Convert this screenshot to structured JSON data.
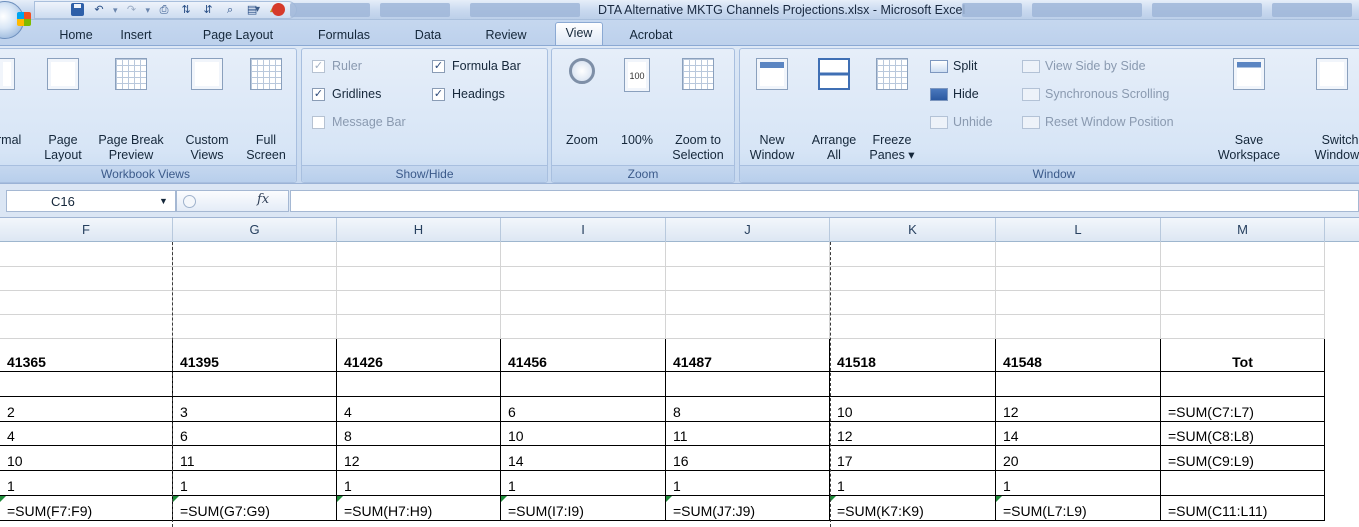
{
  "window": {
    "title": "DTA Alternative MKTG Channels Projections.xlsx - Microsoft Excel"
  },
  "ribbon_tabs": [
    {
      "label": "Home"
    },
    {
      "label": "Insert"
    },
    {
      "label": "Page Layout"
    },
    {
      "label": "Formulas"
    },
    {
      "label": "Data"
    },
    {
      "label": "Review"
    },
    {
      "label": "View",
      "active": true
    },
    {
      "label": "Acrobat"
    }
  ],
  "ribbon": {
    "workbook_views": {
      "label": "Workbook Views",
      "buttons": {
        "normal": "rmal",
        "page_layout": "Page\nLayout",
        "page_break_preview": "Page Break\nPreview",
        "custom_views": "Custom\nViews",
        "full_screen": "Full\nScreen"
      }
    },
    "show_hide": {
      "label": "Show/Hide",
      "ruler": {
        "label": "Ruler",
        "checked": true,
        "enabled": false
      },
      "gridlines": {
        "label": "Gridlines",
        "checked": true
      },
      "message_bar": {
        "label": "Message Bar",
        "checked": false,
        "enabled": false
      },
      "formula_bar": {
        "label": "Formula Bar",
        "checked": true
      },
      "headings": {
        "label": "Headings",
        "checked": true
      }
    },
    "zoom": {
      "label": "Zoom",
      "buttons": {
        "zoom": "Zoom",
        "hundred": "100%",
        "zoom_to_selection": "Zoom to\nSelection"
      },
      "hundred_icon_text": "100"
    },
    "window": {
      "label": "Window",
      "buttons": {
        "new_window": "New\nWindow",
        "arrange_all": "Arrange\nAll",
        "freeze_panes": "Freeze\nPanes ▾",
        "split": "Split",
        "hide": "Hide",
        "unhide": "Unhide",
        "view_side_by_side": "View Side by Side",
        "synchronous_scrolling": "Synchronous Scrolling",
        "reset_window_position": "Reset Window Position",
        "save_workspace": "Save\nWorkspace",
        "switch_windows": "Switch\nWindows"
      }
    }
  },
  "formula_bar": {
    "name_box": "C16",
    "fx_label": "fx",
    "formula": ""
  },
  "sheet": {
    "columns": [
      "F",
      "G",
      "H",
      "I",
      "J",
      "K",
      "L",
      "M"
    ],
    "rows": [
      {
        "cells": [
          "",
          "",
          "",
          "",
          "",
          "",
          "",
          ""
        ]
      },
      {
        "cells": [
          "",
          "",
          "",
          "",
          "",
          "",
          "",
          ""
        ]
      },
      {
        "cells": [
          "",
          "",
          "",
          "",
          "",
          "",
          "",
          ""
        ]
      },
      {
        "cells": [
          "",
          "",
          "",
          "",
          "",
          "",
          "",
          ""
        ]
      },
      {
        "cells": [
          "41365",
          "41395",
          "41426",
          "41456",
          "41487",
          "41518",
          "41548",
          "Tot"
        ],
        "bold": true
      },
      {
        "cells": [
          "",
          "",
          "",
          "",
          "",
          "",
          "",
          ""
        ]
      },
      {
        "cells": [
          "2",
          "3",
          "4",
          "6",
          "8",
          "10",
          "12",
          "=SUM(C7:L7)"
        ]
      },
      {
        "cells": [
          "4",
          "6",
          "8",
          "10",
          "11",
          "12",
          "14",
          "=SUM(C8:L8)"
        ]
      },
      {
        "cells": [
          "10",
          "11",
          "12",
          "14",
          "16",
          "17",
          "20",
          "=SUM(C9:L9)"
        ]
      },
      {
        "cells": [
          "1",
          "1",
          "1",
          "1",
          "1",
          "1",
          "1",
          ""
        ]
      },
      {
        "cells": [
          "=SUM(F7:F9)",
          "=SUM(G7:G9)",
          "=SUM(H7:H9)",
          "=SUM(I7:I9)",
          "=SUM(J7:J9)",
          "=SUM(K7:K9)",
          "=SUM(L7:L9)",
          "=SUM(C11:L11)"
        ],
        "error_flags": true
      }
    ]
  }
}
